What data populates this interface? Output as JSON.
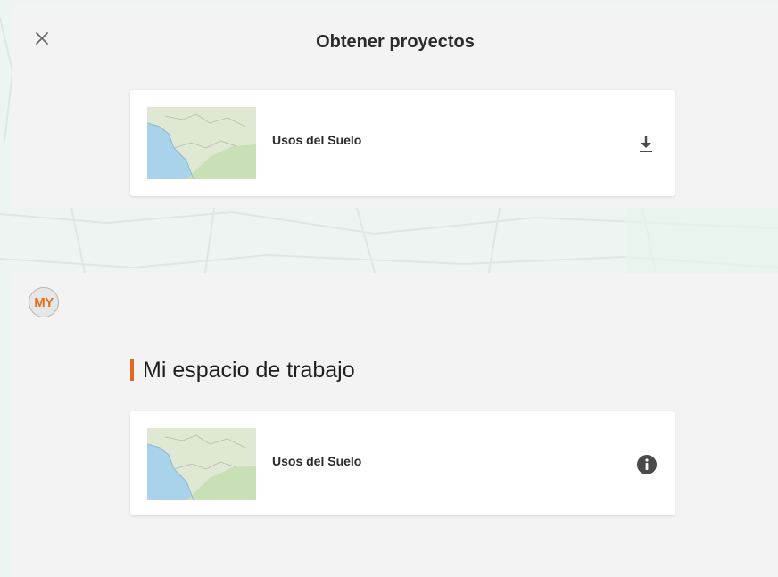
{
  "header": {
    "title": "Obtener proyectos",
    "close_icon": "close-icon"
  },
  "download_list": {
    "items": [
      {
        "label": "Usos del Suelo",
        "action_icon": "download-icon"
      }
    ]
  },
  "user": {
    "initials": "MY"
  },
  "workspace": {
    "title": "Mi espacio de trabajo",
    "items": [
      {
        "label": "Usos del Suelo",
        "action_icon": "info-icon"
      }
    ]
  },
  "colors": {
    "accent": "#e4671f",
    "panel": "#f3f3f3",
    "card": "#ffffff",
    "text": "#2b2b2b"
  }
}
